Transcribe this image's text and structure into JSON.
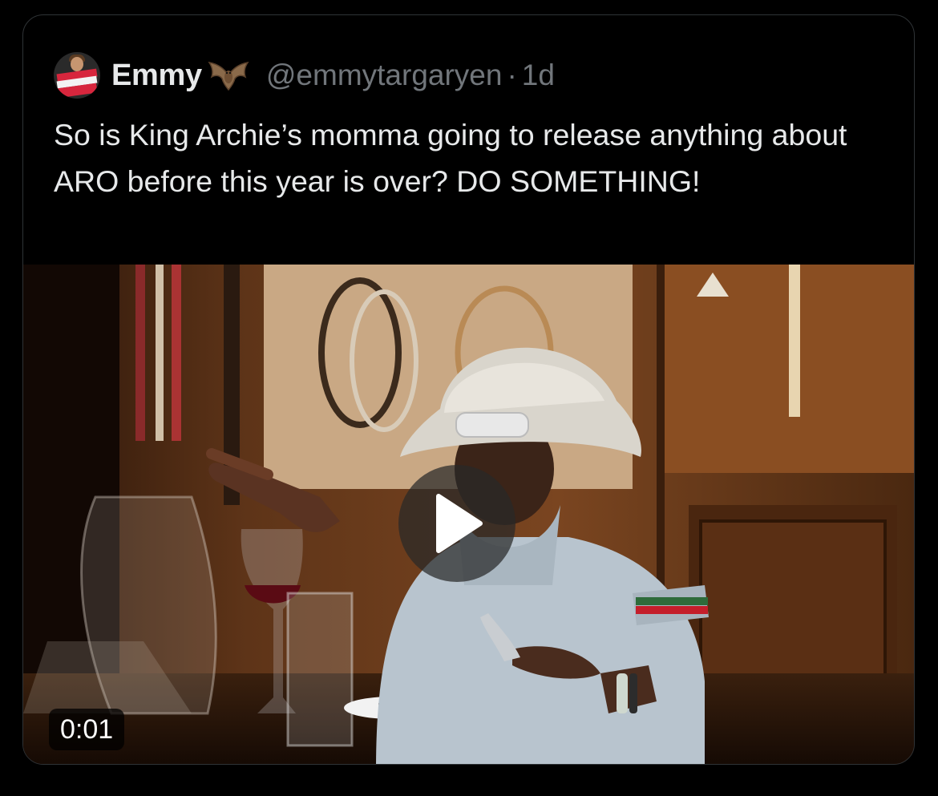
{
  "tweet": {
    "author_name": "Emmy",
    "author_emoji": "bat-icon",
    "handle": "@emmytargaryen",
    "separator": "·",
    "time_ago": "1d",
    "text": "So is King Archie’s momma going to release anything about ARO before this year is over? DO SOMETHING!"
  },
  "media": {
    "type": "video",
    "duration_label": "0:01",
    "play_icon": "play-icon"
  },
  "colors": {
    "background": "#000000",
    "card_border": "#2f3336",
    "primary_text": "#e7e9ea",
    "secondary_text": "#71767b"
  }
}
